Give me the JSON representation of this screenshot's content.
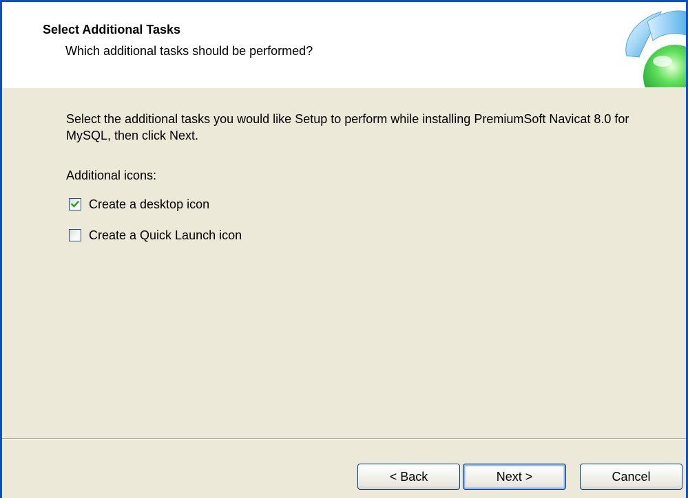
{
  "header": {
    "title": "Select Additional Tasks",
    "subtitle": "Which additional tasks should be performed?",
    "logo_icon": "navicat-logo-icon"
  },
  "main": {
    "intro": "Select the additional tasks you would like Setup to perform while installing PremiumSoft Navicat 8.0 for MySQL, then click Next.",
    "section_label": "Additional icons:",
    "options": [
      {
        "label": "Create a desktop icon",
        "checked": true
      },
      {
        "label": "Create a Quick Launch icon",
        "checked": false
      }
    ]
  },
  "footer": {
    "back_label": "< Back",
    "next_label": "Next >",
    "cancel_label": "Cancel"
  },
  "colors": {
    "window_bg": "#ece9d8",
    "header_bg": "#ffffff",
    "check_mark": "#21a121",
    "focus_ring": "#8cb4f2"
  }
}
